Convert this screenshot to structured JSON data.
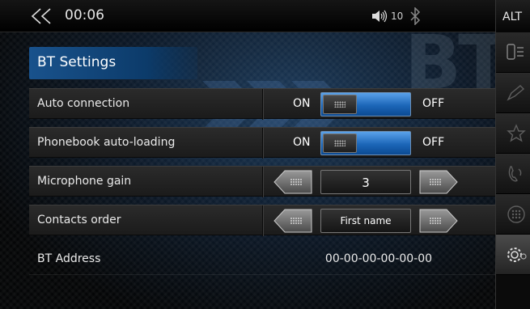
{
  "status_bar": {
    "time": "00:06",
    "volume_level": "10",
    "alt_label": "ALT"
  },
  "background": {
    "watermark": "BT"
  },
  "page": {
    "title": "BT Settings"
  },
  "settings": {
    "auto_connection": {
      "label": "Auto connection",
      "on_label": "ON",
      "off_label": "OFF",
      "state": "ON"
    },
    "phonebook": {
      "label": "Phonebook auto-loading",
      "on_label": "ON",
      "off_label": "OFF",
      "state": "ON"
    },
    "mic_gain": {
      "label": "Microphone gain",
      "value": "3"
    },
    "contacts_order": {
      "label": "Contacts order",
      "value": "First name"
    },
    "bt_address": {
      "label": "BT Address",
      "value": "00-00-00-00-00-00"
    }
  },
  "side_menu": {
    "items": [
      "phone-icon",
      "edit-icon",
      "favorites-icon",
      "call-log-icon",
      "keypad-icon",
      "settings-icon"
    ],
    "active": "settings-icon"
  },
  "colors": {
    "accent": "#1c66b8",
    "title_bg": "#19528c"
  }
}
